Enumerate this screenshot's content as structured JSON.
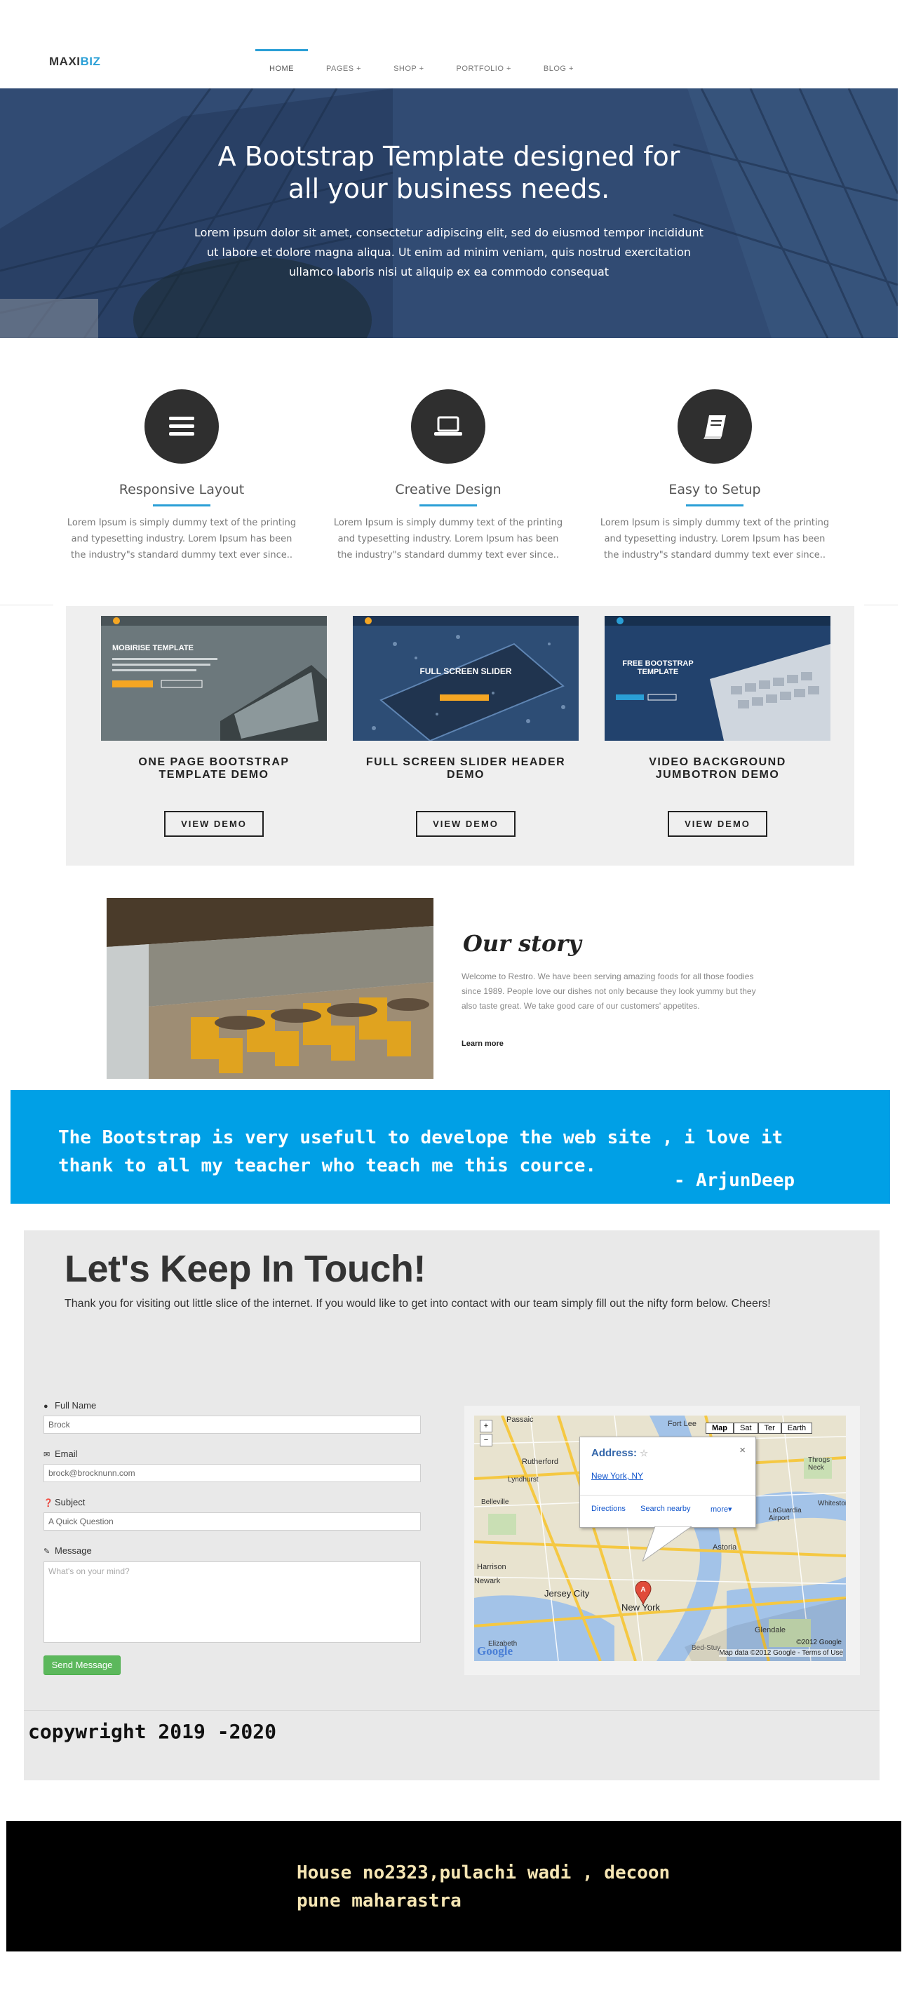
{
  "brand": {
    "part1": "MAXI",
    "part2": "BIZ"
  },
  "nav": {
    "items": [
      {
        "label": "HOME"
      },
      {
        "label": "PAGES +"
      },
      {
        "label": "SHOP +"
      },
      {
        "label": "PORTFOLIO +"
      },
      {
        "label": "BLOG +"
      }
    ]
  },
  "hero": {
    "title_line1": "A Bootstrap Template designed for",
    "title_line2": "all your business needs.",
    "text": "Lorem ipsum dolor sit amet, consectetur adipiscing elit, sed do eiusmod tempor incididunt ut labore et dolore magna aliqua. Ut enim ad minim veniam, quis nostrud exercitation ullamco laboris nisi ut aliquip ex ea commodo consequat"
  },
  "features": [
    {
      "icon": "bars-icon",
      "title": "Responsive Layout",
      "text": "Lorem Ipsum is simply dummy text of the printing and typesetting industry. Lorem Ipsum has been the industry\"s standard dummy text ever since.."
    },
    {
      "icon": "laptop-icon",
      "title": "Creative Design",
      "text": "Lorem Ipsum is simply dummy text of the printing and typesetting industry. Lorem Ipsum has been the industry\"s standard dummy text ever since.."
    },
    {
      "icon": "book-icon",
      "title": "Easy to Setup",
      "text": "Lorem Ipsum is simply dummy text of the printing and typesetting industry. Lorem Ipsum has been the industry\"s standard dummy text ever since.."
    }
  ],
  "demos": [
    {
      "title_line1": "ONE PAGE BOOTSTRAP",
      "title_line2": "TEMPLATE DEMO",
      "button": "VIEW DEMO",
      "thumb_heading": "MOBIRISE TEMPLATE"
    },
    {
      "title_line1": "FULL SCREEN SLIDER HEADER",
      "title_line2": "DEMO",
      "button": "VIEW DEMO",
      "thumb_heading": "FULL SCREEN SLIDER"
    },
    {
      "title_line1": "VIDEO BACKGROUND",
      "title_line2": "JUMBOTRON DEMO",
      "button": "VIEW DEMO",
      "thumb_heading": "FREE BOOTSTRAP TEMPLATE"
    }
  ],
  "story": {
    "title": "Our story",
    "text": "Welcome to Restro. We have been serving amazing foods for all those foodies since 1989. People love our dishes not only because they look yummy but they also taste great. We take good care of our customers' appetites.",
    "link": "Learn more"
  },
  "quote": {
    "text": "The Bootstrap is very usefull to develope the web site , i love it thank to all my teacher who teach me this cource.",
    "author": "- ArjunDeep"
  },
  "contact": {
    "title": "Let's Keep In Touch!",
    "subtitle": "Thank you for visiting out little slice of the internet. If you would like to get into contact with our team simply fill out the nifty form below. Cheers!",
    "fields": {
      "name_label": "Full Name",
      "name_value": "Brock",
      "email_label": "Email",
      "email_value": "brock@brocknunn.com",
      "subject_label": "Subject",
      "subject_value": "A Quick Question",
      "message_label": "Message",
      "message_placeholder": "What's on your mind?"
    },
    "send": "Send Message",
    "map": {
      "types": [
        "Map",
        "Sat",
        "Ter",
        "Earth"
      ],
      "address_label": "Address:",
      "address_value": "New York, NY",
      "actions": [
        "Directions",
        "Search nearby",
        "more▾"
      ],
      "places": [
        "Passaic",
        "Rutherford",
        "Belleville",
        "Lyndhurst",
        "Fort Lee",
        "Harrison",
        "Newark",
        "Jersey City",
        "New York",
        "Astoria",
        "LaGuardia Airport",
        "Glendale",
        "Bed-Stuy",
        "Throgs Neck",
        "Whitestone",
        "Elizabeth"
      ],
      "credit1": "©2012 Google",
      "credit2": "Map data ©2012 Google - Terms of Use",
      "logo": "Google"
    },
    "copyright": "copywright 2019 -2020"
  },
  "footer": {
    "line1": "House no2323,pulachi wadi , decoon",
    "line2": "pune maharastra"
  }
}
